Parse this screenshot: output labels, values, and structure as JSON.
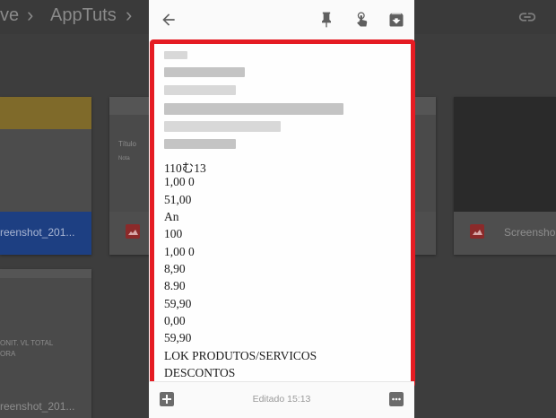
{
  "background": {
    "breadcrumb_left": "ve",
    "breadcrumb_main": "AppTuts",
    "card_left_label": "reenshot_201...",
    "card_right_label": "Screensho",
    "card_mid_title": "Título",
    "card_mid_sub": "Nota",
    "bottom_left_label": "reenshot_201...",
    "side_text_1": "ONIT. VL TOTAL",
    "side_text_2": "ORA"
  },
  "note": {
    "lines": [
      "110む13",
      "1,00 0",
      "51,00",
      "An",
      "100",
      "1,00 0",
      "8,90",
      "8.90",
      "59,90",
      "0,00",
      "59,90",
      "LOK PRODUTOS/SERVICOS",
      "DESCONTOS"
    ]
  },
  "status": {
    "edited": "Editado 15:13"
  },
  "colors": {
    "highlight": "#e51c23",
    "sheet": "#fafafa",
    "backdrop": "#3d3d3d"
  }
}
